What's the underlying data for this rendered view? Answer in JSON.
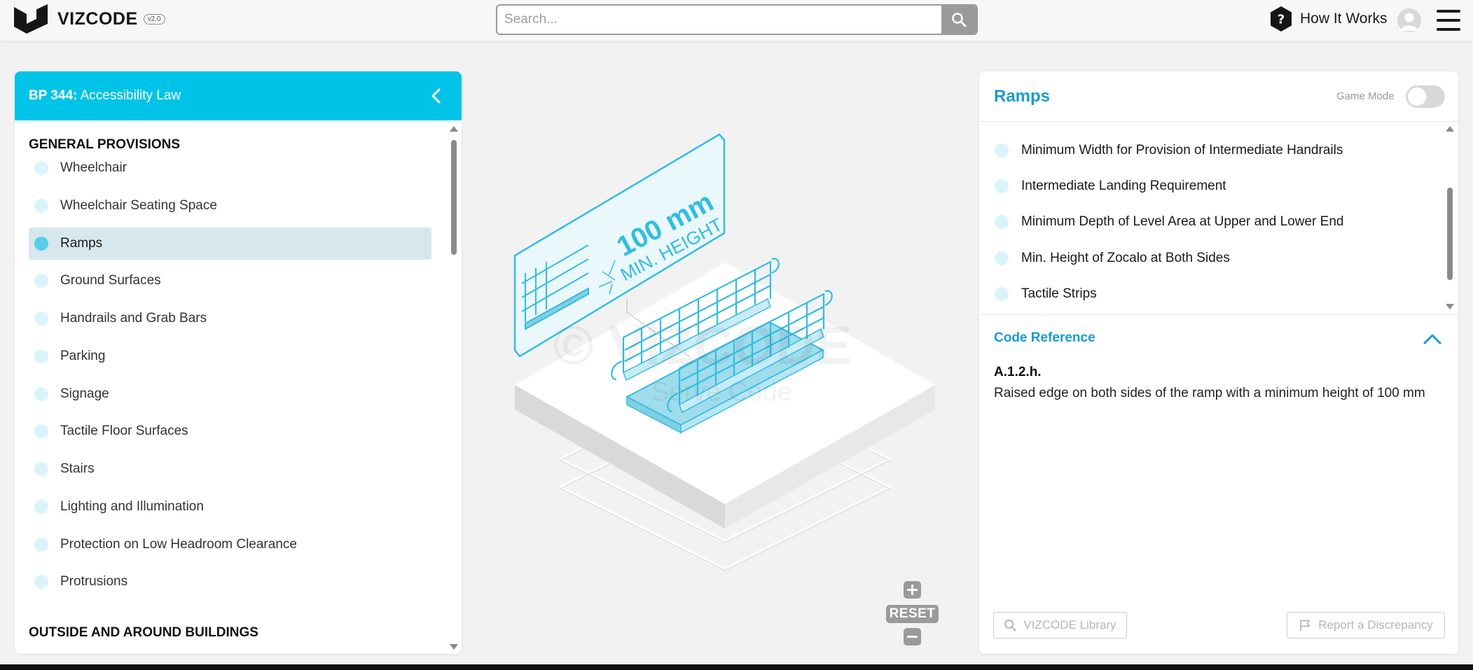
{
  "header": {
    "brand": "VIZCODE",
    "version": "v2.0",
    "search_placeholder": "Search...",
    "help_label": "How It Works"
  },
  "left_panel": {
    "title_code": "BP 344:",
    "title_name": " Accessibility Law",
    "sections": [
      {
        "title": "GENERAL PROVISIONS",
        "items": [
          {
            "label": "Wheelchair",
            "active": false
          },
          {
            "label": "Wheelchair Seating Space",
            "active": false
          },
          {
            "label": "Ramps",
            "active": true
          },
          {
            "label": "Ground Surfaces",
            "active": false
          },
          {
            "label": "Handrails and Grab Bars",
            "active": false
          },
          {
            "label": "Parking",
            "active": false
          },
          {
            "label": "Signage",
            "active": false
          },
          {
            "label": "Tactile Floor Surfaces",
            "active": false
          },
          {
            "label": "Stairs",
            "active": false
          },
          {
            "label": "Lighting and Illumination",
            "active": false
          },
          {
            "label": "Protection on Low Headroom Clearance",
            "active": false
          },
          {
            "label": "Protrusions",
            "active": false
          }
        ]
      },
      {
        "title": "OUTSIDE AND AROUND BUILDINGS",
        "items": []
      }
    ]
  },
  "illustration": {
    "callout_value": "100 mm",
    "callout_label": "MIN. HEIGHT",
    "watermark": "© VIZCODE",
    "watermark_sub": "Serve Code",
    "reset_label": "RESET",
    "accent_color": "#33bde0"
  },
  "right_panel": {
    "title": "Ramps",
    "game_mode_label": "Game Mode",
    "game_mode_on": false,
    "items": [
      "Minimum Width for Provision of Intermediate Handrails",
      "Intermediate Landing Requirement",
      "Minimum Depth of Level Area at Upper and Lower End",
      "Min. Height of Zocalo at Both Sides",
      "Tactile Strips"
    ],
    "code_reference_title": "Code Reference",
    "code_id": "A.1.2.h.",
    "code_text": "Raised edge on both sides of the ramp with a minimum height of 100 mm",
    "library_button": "VIZCODE Library",
    "report_button": "Report a Discrepancy"
  },
  "colors": {
    "brand_cyan": "#00c4e7",
    "title_blue": "#1a9bcf",
    "active_row": "#d7e7ee"
  }
}
